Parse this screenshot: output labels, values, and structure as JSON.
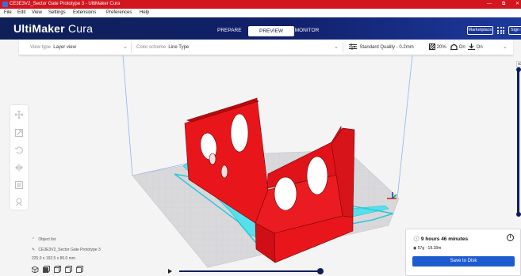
{
  "window": {
    "title": "CE3E3V2_Sector Gate Prototype 3 - UltiMaker Cura",
    "minimize": "—",
    "maximize": "⧉",
    "close": "✕"
  },
  "menu": [
    "File",
    "Edit",
    "View",
    "Settings",
    "Extensions",
    "Preferences",
    "Help"
  ],
  "header": {
    "logo_bold": "UltiMaker",
    "logo_light": "Cura",
    "tabs": [
      "PREPARE",
      "PREVIEW",
      "MONITOR"
    ],
    "active_tab": "PREVIEW",
    "marketplace": "Marketplace",
    "signin": "Sign in"
  },
  "toolbar": {
    "view_type_label": "View type",
    "view_type_value": "Layer view",
    "color_scheme_label": "Color scheme",
    "color_scheme_value": "Line Type",
    "quality": "Standard Quality - 0.2mm",
    "infill": "20%",
    "support": "On",
    "adhesion": "On"
  },
  "layer_slider": {
    "top_label": "40"
  },
  "object_list": {
    "toggle": "Object list",
    "name": "CE3E3V2_Sector Gate Prototype 3",
    "dimensions": "225.0 x 192.5 x 80.0 mm"
  },
  "summary": {
    "time": "9 hours 46 minutes",
    "material": "57g · 19.18m",
    "save_button": "Save to Disk"
  },
  "colors": {
    "accent": "#1e5bcf",
    "header": "#10206a",
    "wall": "#e8161b",
    "support": "#55e0ec",
    "titlebar": "#d3151f"
  }
}
